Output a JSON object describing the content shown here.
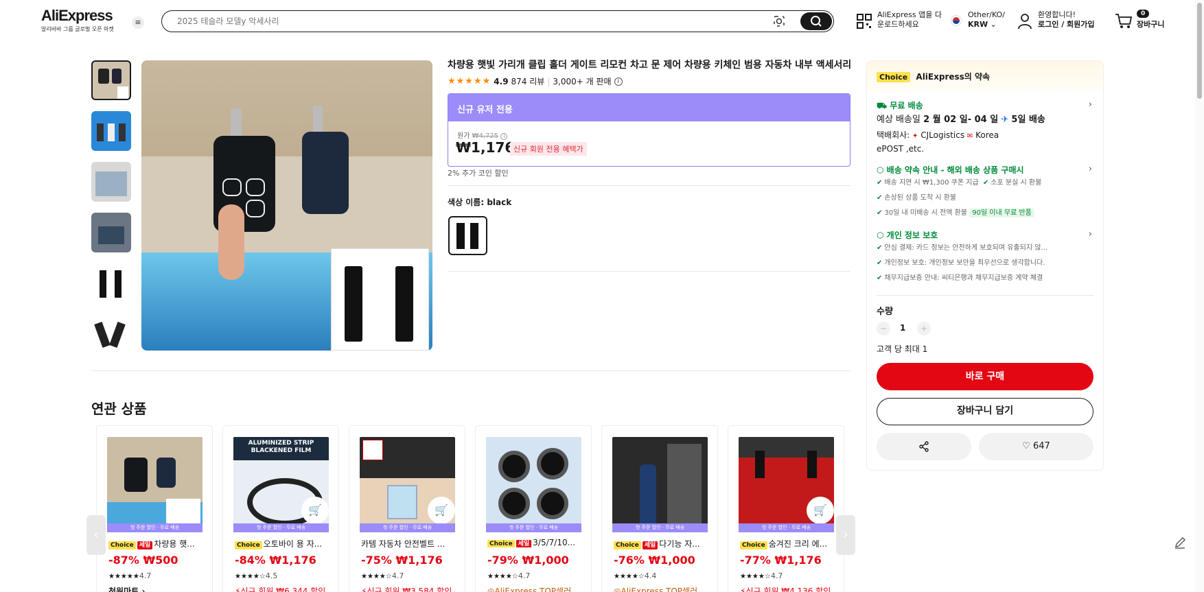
{
  "header": {
    "logo": "AliExpress",
    "logo_sub": "알리바바 그룹 글로벌 오픈 마켓",
    "search_placeholder": "2025 테슬라 모델y 악세사리",
    "app_line1": "AliExpress 앱을 다",
    "app_line2": "운로드하세요",
    "region_line1": "Other/KO/",
    "region_line2": "KRW",
    "account_line1": "환영합니다!",
    "account_line2": "로그인 / 회원가입",
    "cart_count": "0",
    "cart_label": "장바구니"
  },
  "product": {
    "title": "차량용 햇빛 가리개 클립 홀더 게이트 리모컨 차고 문 제어 차량용 키체인 범용 자동차 내부 액세서리",
    "rating": "4.9",
    "reviews": "874 리뷰",
    "sold": "3,000+ 개 판매",
    "promo_header": "신규 유저 전용",
    "orig_label": "원가",
    "orig_price": "₩4,725",
    "price": "₩1,176",
    "new_member_badge": "신규 회원 전용 혜택가",
    "coin_discount": "2% 추가 코인 할인",
    "color_label": "색상 이름: black"
  },
  "sidebar": {
    "choice_tag": "Choice",
    "promise": "AliExpress의 약속",
    "free_shipping": "무료 배송",
    "delivery_prefix": "예상 배송일 ",
    "delivery_dates": "2 월 02 일- 04 일",
    "delivery_days": "5일 배송",
    "carrier_line1_a": "택배회사: ",
    "carrier_line1_b": "CJLogistics",
    "carrier_line1_c": "Korea",
    "carrier_line2": "ePOST ,etc.",
    "delivery_guarantee": "배송 약속 안내 - 해외 배송 상품 구매시",
    "dg_items": [
      "배송 지연 시 ₩1,300 쿠폰 지급",
      "소포 분실 시 환불",
      "손상된 상품 도착 시 환불",
      "30일 내 미배송 시 전액 환불"
    ],
    "free_return": "90일 이내 무료 반품",
    "privacy": "개인 정보 보호",
    "privacy_items": [
      "안심 결제: 카드 정보는 안전하게 보호되며 유출되지 않...",
      "개인정보 보호: 개인정보 보안을 최우선으로 생각합니다.",
      "채무지급보증 안내: 씨티은행과 채무지급보증 계약 체결"
    ],
    "qty_label": "수량",
    "qty_value": "1",
    "max_label": "고객 당 최대 1",
    "buy_now": "바로 구매",
    "add_cart": "장바구니 담기",
    "wishlist_count": "647"
  },
  "related": {
    "title": "연관 상품",
    "banner": "첫 주문 할인 · 무료 배송",
    "cards": [
      {
        "choice": "Choice",
        "sale": "세일",
        "name": "차량용 햇...",
        "discount": "-87%",
        "price": "₩500",
        "rating": "4.7",
        "extra": "천원마트 ›"
      },
      {
        "choice": "Choice",
        "sale": "",
        "name": "오토바이 용 자...",
        "discount": "-84%",
        "price": "₩1,176",
        "rating": "4.5",
        "extra": "신규 회원 ₩6,344 할인"
      },
      {
        "choice": "",
        "sale": "",
        "name": "카템 자동차 안전벨트 ...",
        "discount": "-75%",
        "price": "₩1,176",
        "rating": "4.7",
        "extra": "신규 회원 ₩3,584 할인"
      },
      {
        "choice": "Choice",
        "sale": "세일",
        "name": "3/5/7/10...",
        "discount": "-79%",
        "price": "₩1,000",
        "rating": "4.7",
        "extra": "AliExpress TOP셀러"
      },
      {
        "choice": "Choice",
        "sale": "세일",
        "name": "다기능 자...",
        "discount": "-76%",
        "price": "₩1,000",
        "rating": "4.4",
        "extra": "AliExpress TOP셀러"
      },
      {
        "choice": "Choice",
        "sale": "",
        "name": "숨겨진 크리 에...",
        "discount": "-77%",
        "price": "₩1,176",
        "rating": "4.7",
        "extra": "신규 회원 ₩4,136 할인"
      }
    ]
  }
}
